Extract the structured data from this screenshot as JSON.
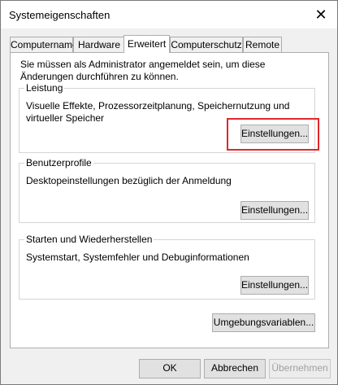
{
  "window": {
    "title": "Systemeigenschaften",
    "close_glyph": "✕"
  },
  "tabs": [
    {
      "label": "Computername"
    },
    {
      "label": "Hardware"
    },
    {
      "label": "Erweitert",
      "active": true
    },
    {
      "label": "Computerschutz"
    },
    {
      "label": "Remote"
    }
  ],
  "panel": {
    "admin_notice": "Sie müssen als Administrator angemeldet sein, um diese Änderungen durchführen zu können.",
    "performance": {
      "label": "Leistung",
      "description": "Visuelle Effekte, Prozessorzeitplanung, Speichernutzung und virtueller Speicher",
      "button": "Einstellungen..."
    },
    "user_profiles": {
      "label": "Benutzerprofile",
      "description": "Desktopeinstellungen bezüglich der Anmeldung",
      "button": "Einstellungen..."
    },
    "startup_recovery": {
      "label": "Starten und Wiederherstellen",
      "description": "Systemstart, Systemfehler und Debuginformationen",
      "button": "Einstellungen..."
    },
    "env_button": "Umgebungsvariablen..."
  },
  "footer": {
    "ok": "OK",
    "cancel": "Abbrechen",
    "apply": "Übernehmen"
  },
  "colors": {
    "highlight": "#e0282a"
  },
  "icons": {
    "close": "close-icon"
  }
}
